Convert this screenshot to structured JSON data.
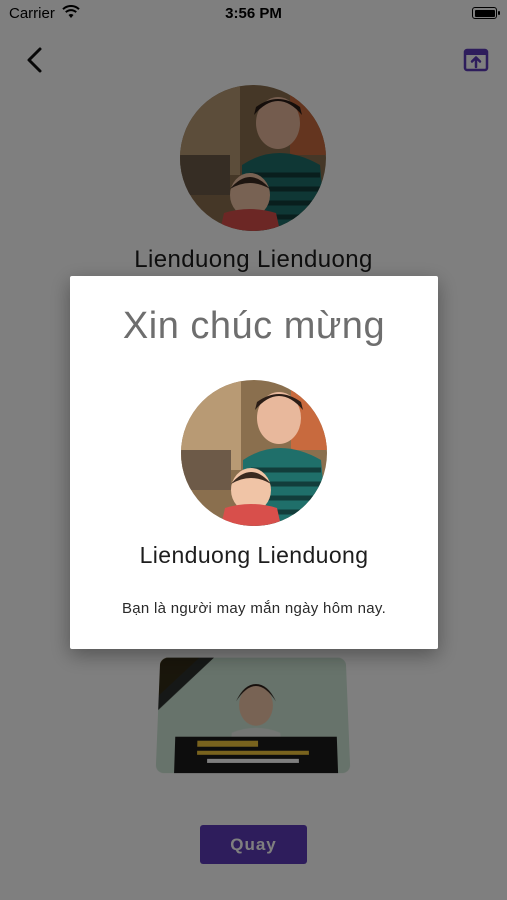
{
  "status_bar": {
    "carrier": "Carrier",
    "time": "3:56 PM"
  },
  "colors": {
    "accent": "#5c3bb8",
    "dim_overlay": "rgba(0,0,0,0.5)"
  },
  "icons": {
    "back": "chevron-left-icon",
    "share": "open-in-new-icon"
  },
  "profile": {
    "name": "Lienduong Lienduong"
  },
  "spin_button": {
    "label": "Quay"
  },
  "dialog": {
    "title": "Xin chúc mừng",
    "name": "Lienduong Lienduong",
    "message": "Bạn là người may mắn ngày hôm nay."
  }
}
